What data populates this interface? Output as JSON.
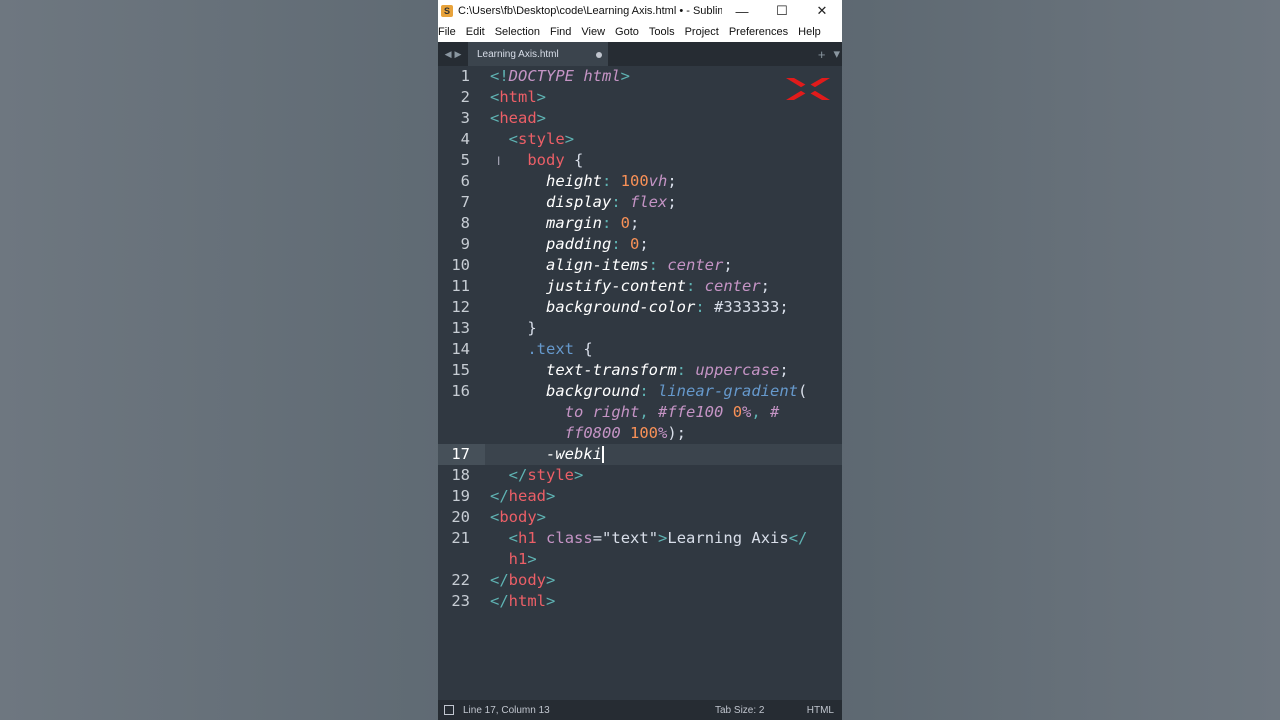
{
  "window": {
    "title": "C:\\Users\\fb\\Desktop\\code\\Learning Axis.html • - Sublime Te...",
    "controls": {
      "minimize": "—",
      "maximize": "☐",
      "close": "✕"
    }
  },
  "menu": [
    "File",
    "Edit",
    "Selection",
    "Find",
    "View",
    "Goto",
    "Tools",
    "Project",
    "Preferences",
    "Help"
  ],
  "tab": {
    "label": "Learning Axis.html"
  },
  "tabbar": {
    "new_tab": "+",
    "dropdown": "▾"
  },
  "editor": {
    "line_numbers": [
      "1",
      "2",
      "3",
      "4",
      "5",
      "6",
      "7",
      "8",
      "9",
      "10",
      "11",
      "12",
      "13",
      "14",
      "15",
      "16",
      "",
      "",
      "17",
      "18",
      "19",
      "20",
      "21",
      "",
      "22",
      "23"
    ],
    "active_line": "17",
    "tokens": {
      "l1": [
        "<!",
        "DOCTYPE",
        " ",
        "html",
        ">"
      ],
      "l2": [
        "<",
        "html",
        ">"
      ],
      "l3": [
        "<",
        "head",
        ">"
      ],
      "l4": [
        "<",
        "style",
        ">"
      ],
      "l5": [
        "body",
        " {"
      ],
      "l6": [
        "height",
        ": ",
        "100",
        "vh",
        ";"
      ],
      "l7": [
        "display",
        ": ",
        "flex",
        ";"
      ],
      "l8": [
        "margin",
        ": ",
        "0",
        ";"
      ],
      "l9": [
        "padding",
        ": ",
        "0",
        ";"
      ],
      "l10": [
        "align-items",
        ": ",
        "center",
        ";"
      ],
      "l11": [
        "justify-content",
        ": ",
        "center",
        ";"
      ],
      "l12": [
        "background-color",
        ": ",
        "#333333",
        ";"
      ],
      "l13": [
        "}"
      ],
      "l14": [
        ".text",
        " {"
      ],
      "l15": [
        "text-transform",
        ": ",
        "uppercase",
        ";"
      ],
      "l16a": [
        "background",
        ": ",
        "linear-gradient",
        "("
      ],
      "l16b": [
        "to",
        " ",
        "right",
        ", ",
        "#ffe100",
        " ",
        "0",
        "%",
        ", ",
        "#"
      ],
      "l16c": [
        "ff0800",
        " ",
        "100",
        "%",
        ");"
      ],
      "l17": [
        "-webki"
      ],
      "l18": [
        "</",
        "style",
        ">"
      ],
      "l19": [
        "</",
        "head",
        ">"
      ],
      "l20": [
        "<",
        "body",
        ">"
      ],
      "l21a": [
        "<",
        "h1",
        " ",
        "class",
        "=",
        "\"text\"",
        ">",
        "Learning Axis",
        "</"
      ],
      "l21b": [
        "h1",
        ">"
      ],
      "l22": [
        "</",
        "body",
        ">"
      ],
      "l23": [
        "</",
        "html",
        ">"
      ]
    }
  },
  "status": {
    "position": "Line 17, Column 13",
    "tab_size": "Tab Size: 2",
    "syntax": "HTML"
  },
  "colors": {
    "background": "#303841",
    "tag": "#ec5f67",
    "punctuation": "#5fb3b3",
    "number": "#f99157",
    "string": "#99c794",
    "function": "#6699cc",
    "keyword": "#c594c5"
  }
}
